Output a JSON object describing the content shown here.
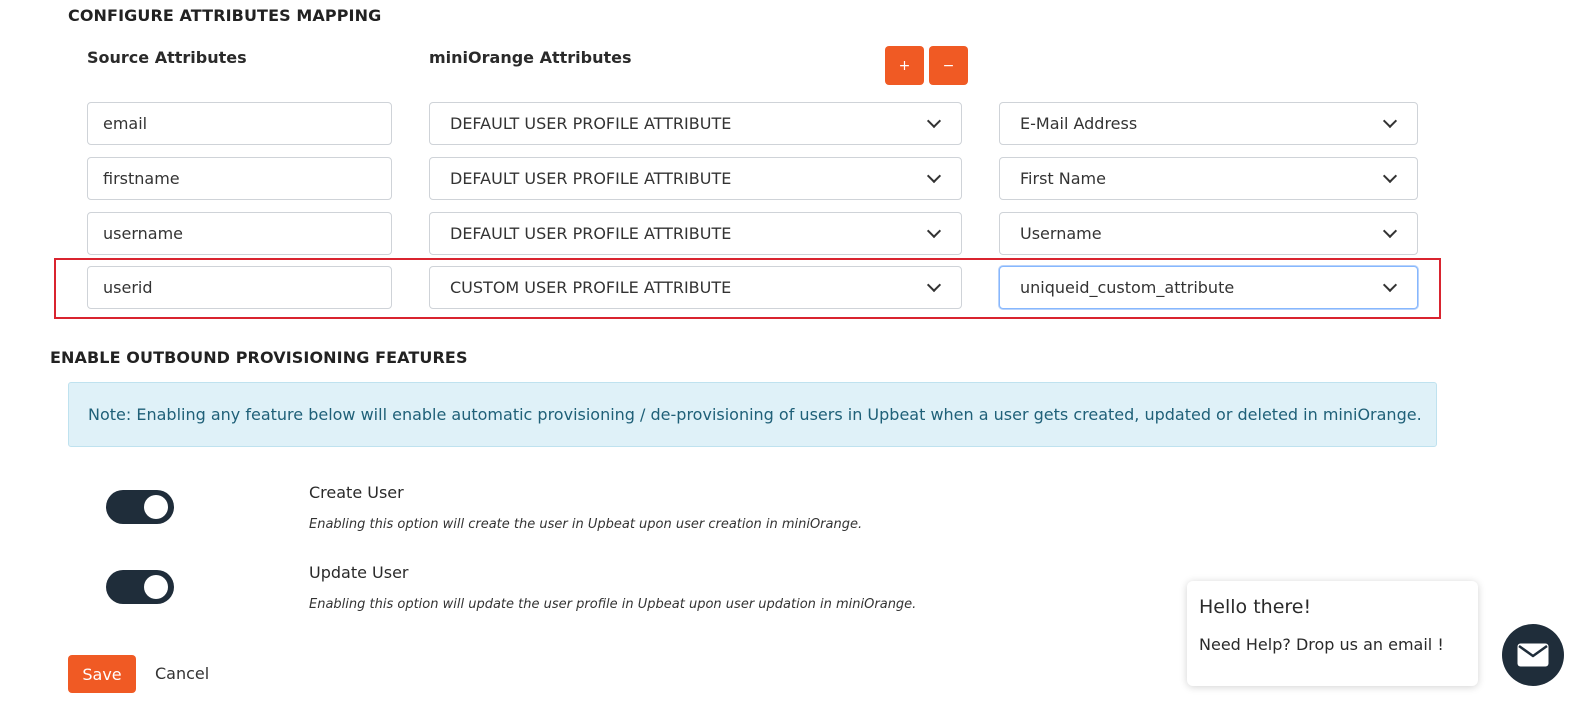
{
  "mapping": {
    "title": "CONFIGURE ATTRIBUTES MAPPING",
    "source_header": "Source Attributes",
    "mo_header": "miniOrange Attributes",
    "add_label": "+",
    "remove_label": "−",
    "rows": [
      {
        "source": "email",
        "type": "DEFAULT USER PROFILE ATTRIBUTE",
        "attribute": "E-Mail Address"
      },
      {
        "source": "firstname",
        "type": "DEFAULT USER PROFILE ATTRIBUTE",
        "attribute": "First Name"
      },
      {
        "source": "username",
        "type": "DEFAULT USER PROFILE ATTRIBUTE",
        "attribute": "Username"
      },
      {
        "source": "userid",
        "type": "CUSTOM USER PROFILE ATTRIBUTE",
        "attribute": "uniqueid_custom_attribute",
        "highlighted": true
      }
    ]
  },
  "provisioning": {
    "title": "ENABLE OUTBOUND PROVISIONING FEATURES",
    "note": "Note: Enabling any feature below will enable automatic provisioning / de-provisioning of users in Upbeat when a user gets created, updated or deleted in miniOrange.",
    "features": [
      {
        "title": "Create User",
        "description": "Enabling this option will create the user in Upbeat upon user creation in miniOrange.",
        "enabled": true
      },
      {
        "title": "Update User",
        "description": "Enabling this option will update the user profile in Upbeat upon user updation in miniOrange.",
        "enabled": true
      }
    ]
  },
  "actions": {
    "save_label": "Save",
    "cancel_label": "Cancel"
  },
  "chat": {
    "greeting": "Hello there!",
    "message": "Need Help? Drop us an email !",
    "icon": "envelope-icon"
  },
  "colors": {
    "accent": "#f05a24",
    "toggle_on": "#1f2d3a",
    "highlight": "#d9242f",
    "note_bg": "#dff1f8"
  }
}
